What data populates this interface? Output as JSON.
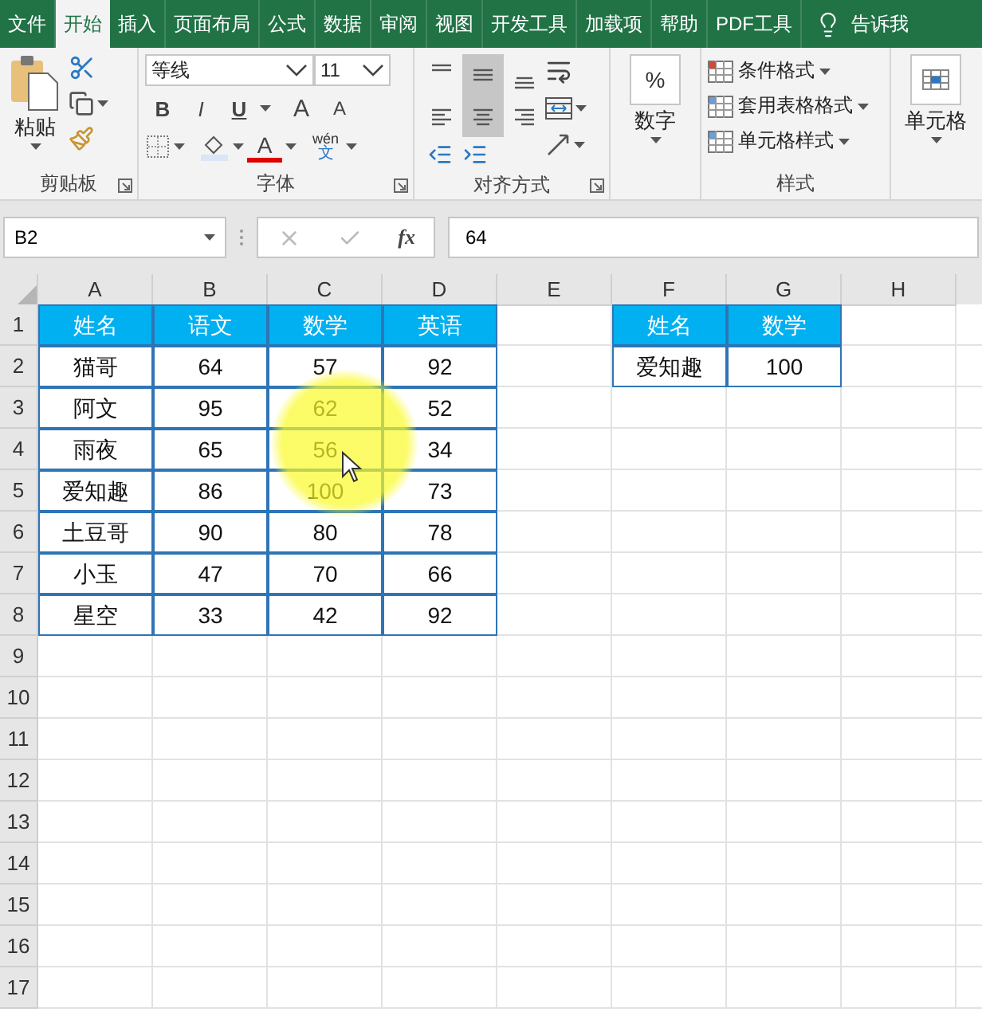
{
  "tabs": [
    {
      "label": "文件",
      "selected": false
    },
    {
      "label": "开始",
      "selected": true
    },
    {
      "label": "插入",
      "selected": false
    },
    {
      "label": "页面布局",
      "selected": false
    },
    {
      "label": "公式",
      "selected": false
    },
    {
      "label": "数据",
      "selected": false
    },
    {
      "label": "审阅",
      "selected": false
    },
    {
      "label": "视图",
      "selected": false
    },
    {
      "label": "开发工具",
      "selected": false
    },
    {
      "label": "加载项",
      "selected": false
    },
    {
      "label": "帮助",
      "selected": false
    },
    {
      "label": "PDF工具",
      "selected": false
    }
  ],
  "tell_me": "告诉我",
  "ribbon": {
    "clipboard": {
      "paste": "粘贴",
      "label": "剪贴板"
    },
    "font": {
      "name": "等线",
      "size": "11",
      "bold": "B",
      "italic": "I",
      "underline": "U",
      "grow": "A",
      "shrink": "A",
      "font_color_letter": "A",
      "phonetic_top": "wén",
      "phonetic_bottom": "文",
      "label": "字体"
    },
    "alignment": {
      "buttons": [
        {
          "kind": "top",
          "selected": false
        },
        {
          "kind": "middle",
          "selected": true
        },
        {
          "kind": "bottom",
          "selected": false
        },
        {
          "kind": "left",
          "selected": false
        },
        {
          "kind": "center",
          "selected": true
        },
        {
          "kind": "right",
          "selected": false
        }
      ],
      "label": "对齐方式"
    },
    "number": {
      "symbol": "%",
      "label": "数字"
    },
    "styles": {
      "items": [
        "条件格式",
        "套用表格格式",
        "单元格样式"
      ],
      "label": "样式"
    },
    "cells": {
      "label": "单元格"
    }
  },
  "formula_bar": {
    "name_box": "B2",
    "fx": "fx",
    "value": "64"
  },
  "sheet": {
    "columns": [
      "A",
      "B",
      "C",
      "D",
      "E",
      "F",
      "G",
      "H"
    ],
    "row_numbers": [
      "1",
      "2",
      "3",
      "4",
      "5",
      "6",
      "7",
      "8",
      "9",
      "10",
      "11",
      "12",
      "13",
      "14",
      "15",
      "16",
      "17"
    ],
    "tables": [
      {
        "header": [
          "姓名",
          "语文",
          "数学",
          "英语"
        ],
        "rows": [
          [
            "猫哥",
            "64",
            "57",
            "92"
          ],
          [
            "阿文",
            "95",
            "62",
            "52"
          ],
          [
            "雨夜",
            "65",
            "56",
            "34"
          ],
          [
            "爱知趣",
            "86",
            "100",
            "73"
          ],
          [
            "土豆哥",
            "90",
            "80",
            "78"
          ],
          [
            "小玉",
            "47",
            "70",
            "66"
          ],
          [
            "星空",
            "33",
            "42",
            "92"
          ]
        ]
      },
      {
        "header": [
          "姓名",
          "数学"
        ],
        "rows": [
          [
            "爱知趣",
            "100"
          ]
        ]
      }
    ]
  }
}
